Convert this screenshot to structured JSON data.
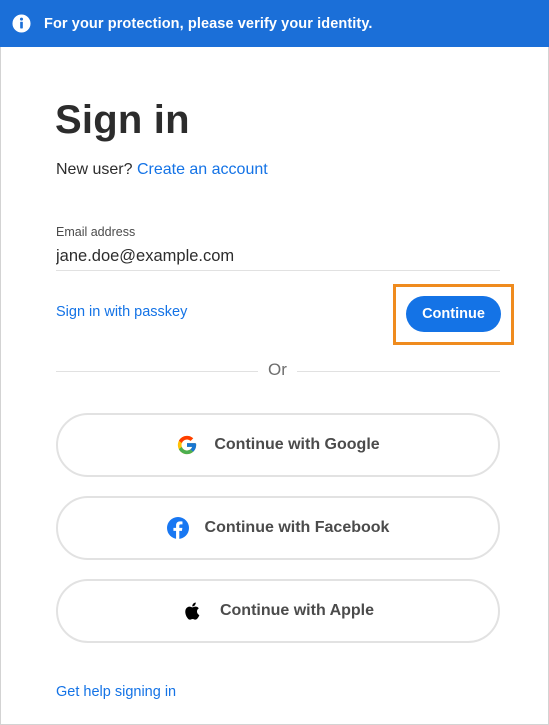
{
  "banner": {
    "icon": "info-icon",
    "text": "For your protection, please verify your identity."
  },
  "page": {
    "title": "Sign in",
    "new_user_prompt": "New user?",
    "create_account_link": "Create an account"
  },
  "form": {
    "email_label": "Email address",
    "email_value": "jane.doe@example.com",
    "passkey_link": "Sign in with passkey",
    "continue_label": "Continue"
  },
  "divider": {
    "text": "Or"
  },
  "social": [
    {
      "icon": "google-icon",
      "label": "Continue with Google"
    },
    {
      "icon": "facebook-icon",
      "label": "Continue with Facebook"
    },
    {
      "icon": "apple-icon",
      "label": "Continue with Apple"
    }
  ],
  "footer": {
    "help_link": "Get help signing in"
  },
  "colors": {
    "accent": "#1473e6",
    "banner": "#1b6fd8",
    "highlight": "#ef8b1e",
    "text": "#2c2c2c"
  }
}
